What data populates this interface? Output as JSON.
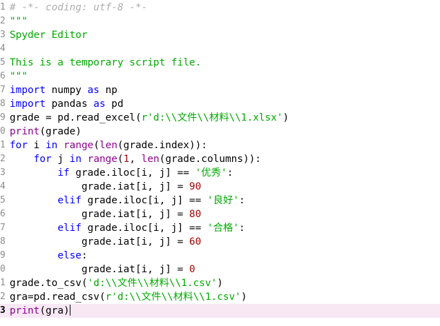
{
  "editor": {
    "current_line_index": 22,
    "lines": [
      {
        "num": "1",
        "tokens": [
          {
            "t": "# -*- coding: utf-8 -*-",
            "c": "cm"
          }
        ]
      },
      {
        "num": "2",
        "tokens": [
          {
            "t": "\"\"\"",
            "c": "st"
          }
        ]
      },
      {
        "num": "3",
        "tokens": [
          {
            "t": "Spyder Editor",
            "c": "st"
          }
        ]
      },
      {
        "num": "4",
        "tokens": []
      },
      {
        "num": "5",
        "tokens": [
          {
            "t": "This is a temporary script file.",
            "c": "st"
          }
        ]
      },
      {
        "num": "6",
        "tokens": [
          {
            "t": "\"\"\"",
            "c": "st"
          }
        ]
      },
      {
        "num": "7",
        "tokens": [
          {
            "t": "import",
            "c": "kw"
          },
          {
            "t": " numpy ",
            "c": ""
          },
          {
            "t": "as",
            "c": "kw"
          },
          {
            "t": " np",
            "c": ""
          }
        ]
      },
      {
        "num": "8",
        "tokens": [
          {
            "t": "import",
            "c": "kw"
          },
          {
            "t": " pandas ",
            "c": ""
          },
          {
            "t": "as",
            "c": "kw"
          },
          {
            "t": " pd",
            "c": ""
          }
        ]
      },
      {
        "num": "9",
        "tokens": [
          {
            "t": "grade = pd.read_excel(",
            "c": ""
          },
          {
            "t": "r'd:\\\\文件\\\\材料\\\\1.xlsx'",
            "c": "st"
          },
          {
            "t": ")",
            "c": ""
          }
        ]
      },
      {
        "num": "0",
        "tokens": [
          {
            "t": "print",
            "c": "bi"
          },
          {
            "t": "(grade)",
            "c": ""
          }
        ]
      },
      {
        "num": "1",
        "tokens": [
          {
            "t": "for",
            "c": "kw"
          },
          {
            "t": " i ",
            "c": ""
          },
          {
            "t": "in",
            "c": "kw"
          },
          {
            "t": " ",
            "c": ""
          },
          {
            "t": "range",
            "c": "bi"
          },
          {
            "t": "(",
            "c": ""
          },
          {
            "t": "len",
            "c": "bi"
          },
          {
            "t": "(grade.index)):",
            "c": ""
          }
        ]
      },
      {
        "num": "2",
        "tokens": [
          {
            "t": "    ",
            "c": ""
          },
          {
            "t": "for",
            "c": "kw"
          },
          {
            "t": " j ",
            "c": ""
          },
          {
            "t": "in",
            "c": "kw"
          },
          {
            "t": " ",
            "c": ""
          },
          {
            "t": "range",
            "c": "bi"
          },
          {
            "t": "(",
            "c": ""
          },
          {
            "t": "1",
            "c": "nm"
          },
          {
            "t": ", ",
            "c": ""
          },
          {
            "t": "len",
            "c": "bi"
          },
          {
            "t": "(grade.columns)):",
            "c": ""
          }
        ]
      },
      {
        "num": "3",
        "tokens": [
          {
            "t": "        ",
            "c": ""
          },
          {
            "t": "if",
            "c": "kw"
          },
          {
            "t": " grade.iloc[i, j] == ",
            "c": ""
          },
          {
            "t": "'优秀'",
            "c": "st"
          },
          {
            "t": ":",
            "c": ""
          }
        ]
      },
      {
        "num": "4",
        "tokens": [
          {
            "t": "            grade.iat[i, j] = ",
            "c": ""
          },
          {
            "t": "90",
            "c": "nm"
          }
        ]
      },
      {
        "num": "5",
        "tokens": [
          {
            "t": "        ",
            "c": ""
          },
          {
            "t": "elif",
            "c": "kw"
          },
          {
            "t": " grade.iloc[i, j] == ",
            "c": ""
          },
          {
            "t": "'良好'",
            "c": "st"
          },
          {
            "t": ":",
            "c": ""
          }
        ]
      },
      {
        "num": "6",
        "tokens": [
          {
            "t": "            grade.iat[i, j] = ",
            "c": ""
          },
          {
            "t": "80",
            "c": "nm"
          }
        ]
      },
      {
        "num": "7",
        "tokens": [
          {
            "t": "        ",
            "c": ""
          },
          {
            "t": "elif",
            "c": "kw"
          },
          {
            "t": " grade.iloc[i, j] == ",
            "c": ""
          },
          {
            "t": "'合格'",
            "c": "st"
          },
          {
            "t": ":",
            "c": ""
          }
        ]
      },
      {
        "num": "8",
        "tokens": [
          {
            "t": "            grade.iat[i, j] = ",
            "c": ""
          },
          {
            "t": "60",
            "c": "nm"
          }
        ]
      },
      {
        "num": "9",
        "tokens": [
          {
            "t": "        ",
            "c": ""
          },
          {
            "t": "else",
            "c": "kw"
          },
          {
            "t": ":",
            "c": ""
          }
        ]
      },
      {
        "num": "0",
        "tokens": [
          {
            "t": "            grade.iat[i, j] = ",
            "c": ""
          },
          {
            "t": "0",
            "c": "nm"
          }
        ]
      },
      {
        "num": "1",
        "tokens": [
          {
            "t": "grade.to_csv(",
            "c": ""
          },
          {
            "t": "'d:\\\\文件\\\\材料\\\\1.csv'",
            "c": "st"
          },
          {
            "t": ")",
            "c": ""
          }
        ]
      },
      {
        "num": "2",
        "tokens": [
          {
            "t": "gra=pd.read_csv(",
            "c": ""
          },
          {
            "t": "r'd:\\\\文件\\\\材料\\\\1.csv'",
            "c": "st"
          },
          {
            "t": ")",
            "c": ""
          }
        ]
      },
      {
        "num": "3",
        "tokens": [
          {
            "t": "print",
            "c": "bi"
          },
          {
            "t": "(gra)",
            "c": ""
          }
        ]
      }
    ]
  },
  "colors": {
    "keyword": "#0000ff",
    "builtin": "#900090",
    "string": "#00aa00",
    "number": "#aa0000",
    "comment": "#adadad",
    "current_line_bg": "#f7e8f4"
  }
}
